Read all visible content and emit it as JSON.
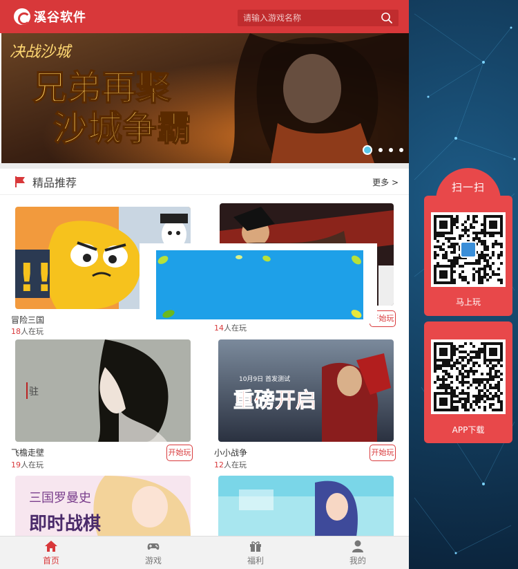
{
  "header": {
    "brand": "溪谷软件",
    "search_placeholder": "请输入游戏名称"
  },
  "banner": {
    "tag": "决战沙城",
    "line1": "兄弟再聚",
    "line2": "沙城争霸",
    "slides": 4,
    "active_slide": 1
  },
  "section": {
    "title": "精品推荐",
    "more": "更多 >"
  },
  "games": [
    {
      "name": "冒险三国",
      "count": "18",
      "suffix": "人在玩",
      "button": ""
    },
    {
      "name": "",
      "count": "14",
      "suffix": "人在玩",
      "button": "开始玩"
    },
    {
      "name": "飞檐走壁",
      "count": "19",
      "suffix": "人在玩",
      "button": "开始玩"
    },
    {
      "name": "小小战争",
      "count": "12",
      "suffix": "人在玩",
      "button": "开始玩"
    }
  ],
  "games_partial": [
    {
      "thumb_text": "三国罗曼史",
      "thumb_text2": "即时战棋"
    },
    {
      "thumb_text": ""
    }
  ],
  "thumb_texts": {
    "g2_title": "重磅开启",
    "g2_sub": "10月9日 首发测试",
    "g1_seal": "驻"
  },
  "tabbar": [
    {
      "label": "首页",
      "icon": "home-icon",
      "active": true
    },
    {
      "label": "游戏",
      "icon": "gamepad-icon",
      "active": false
    },
    {
      "label": "福利",
      "icon": "gift-icon",
      "active": false
    },
    {
      "label": "我的",
      "icon": "user-icon",
      "active": false
    }
  ],
  "side": {
    "title": "扫一扫",
    "qr1_label": "马上玩",
    "qr2_label": "APP下载"
  },
  "colors": {
    "brand": "#d8383a",
    "side": "#e8484a",
    "background": "#0b2440"
  }
}
